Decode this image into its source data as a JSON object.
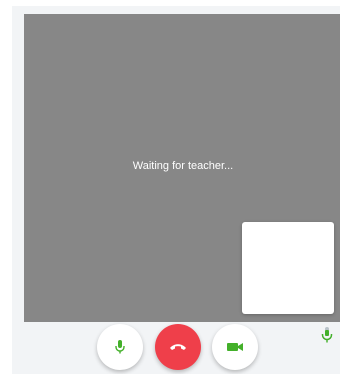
{
  "video": {
    "status_text": "Waiting for teacher..."
  },
  "controls": {
    "mic_icon": "mic-icon",
    "hangup_icon": "phone-hangup-icon",
    "camera_icon": "videocam-icon"
  },
  "indicators": {
    "mic_level_icon": "mic-level-icon"
  },
  "colors": {
    "video_bg": "#878787",
    "panel_bg": "#f2f4f6",
    "accent_green": "#43b02a",
    "hangup_red": "#ef3f4a"
  }
}
